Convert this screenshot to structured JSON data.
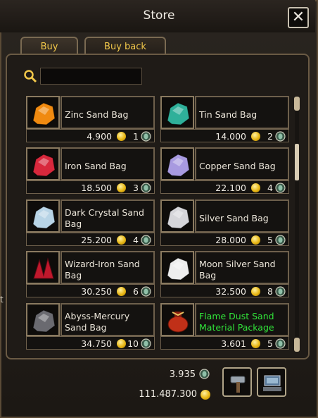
{
  "window": {
    "title": "Store",
    "close_label": "✕"
  },
  "tabs": [
    {
      "label": "Buy",
      "active": true
    },
    {
      "label": "Buy back",
      "active": false
    }
  ],
  "search": {
    "value": "",
    "placeholder": ""
  },
  "items": [
    {
      "name": "Zinc Sand Bag",
      "price": "4.900",
      "qty": "1",
      "icon": "orange-ore-icon",
      "color": "#f08a10"
    },
    {
      "name": "Tin Sand Bag",
      "price": "14.000",
      "qty": "2",
      "icon": "teal-ore-icon",
      "color": "#2fb09a"
    },
    {
      "name": "Iron Sand Bag",
      "price": "18.500",
      "qty": "3",
      "icon": "red-ore-icon",
      "color": "#d8283c"
    },
    {
      "name": "Copper Sand Bag",
      "price": "22.100",
      "qty": "4",
      "icon": "lavender-ore-icon",
      "color": "#a89ae0"
    },
    {
      "name": "Dark Crystal Sand Bag",
      "price": "25.200",
      "qty": "4",
      "icon": "pale-blue-ore-icon",
      "color": "#b8d4e6"
    },
    {
      "name": "Silver Sand Bag",
      "price": "28.000",
      "qty": "5",
      "icon": "silver-ore-icon",
      "color": "#d6d6da"
    },
    {
      "name": "Wizard-Iron Sand Bag",
      "price": "30.250",
      "qty": "6",
      "icon": "crimson-crystal-icon",
      "color": "#c0182c"
    },
    {
      "name": "Moon Silver Sand Bag",
      "price": "32.500",
      "qty": "8",
      "icon": "white-ore-icon",
      "color": "#eeeeee"
    },
    {
      "name": "Abyss-Mercury Sand Bag",
      "price": "34.750",
      "qty": "10",
      "icon": "dark-gray-ore-icon",
      "color": "#6a6a70"
    },
    {
      "name": "Flame Dust Sand Material Package",
      "price": "3.601",
      "qty": "5",
      "icon": "red-pouch-icon",
      "color": "#c03018",
      "name_color": "green"
    }
  ],
  "footer": {
    "gems_total": "3.935",
    "gold_total": "111.487.300"
  },
  "side_text": "t",
  "colors": {
    "accent": "#f2c84a",
    "green_text": "#31e43a",
    "gold": "#e7b614"
  }
}
